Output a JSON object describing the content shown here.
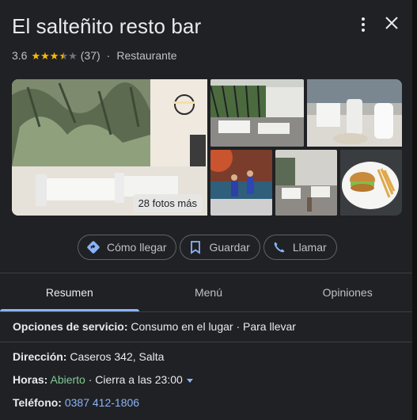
{
  "place": {
    "name": "El salteñito resto bar",
    "rating": "3.6",
    "rating_value": 3.6,
    "rating_max": 5,
    "reviews_count": "(37)",
    "separator": "·",
    "category": "Restaurante"
  },
  "photos": {
    "more_label": "28 fotos más"
  },
  "actions": {
    "directions": "Cómo llegar",
    "save": "Guardar",
    "call": "Llamar"
  },
  "tabs": [
    {
      "label": "Resumen",
      "active": true
    },
    {
      "label": "Menú",
      "active": false
    },
    {
      "label": "Opiniones",
      "active": false
    }
  ],
  "service": {
    "label": "Opciones de servicio:",
    "value": "Consumo en el lugar · Para llevar"
  },
  "address": {
    "label": "Dirección:",
    "value": "Caseros 342, Salta"
  },
  "hours": {
    "label": "Horas:",
    "status": "Abierto",
    "detail": "· Cierra a las 23:00"
  },
  "phone": {
    "label": "Teléfono:",
    "value": "0387 412-1806"
  },
  "colors": {
    "background": "#202124",
    "accent": "#8ab4f8",
    "open": "#81c995",
    "star": "#fbbc04"
  },
  "icons": [
    "more-vert-icon",
    "close-icon",
    "directions-icon",
    "bookmark-icon",
    "phone-icon",
    "dropdown-arrow-icon"
  ]
}
